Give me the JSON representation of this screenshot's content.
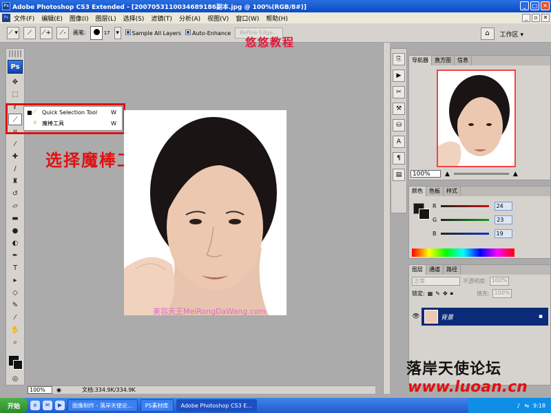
{
  "window": {
    "title": "Adobe Photoshop CS3 Extended - [2007053110034689186副本.jpg @ 100%(RGB/8#)]",
    "ctrl_min": "_",
    "ctrl_max": "□",
    "ctrl_close": "✕"
  },
  "menubar": {
    "items": [
      "文件(F)",
      "编辑(E)",
      "图像(I)",
      "图层(L)",
      "选择(S)",
      "滤镜(T)",
      "分析(A)",
      "视图(V)",
      "窗口(W)",
      "帮助(H)"
    ]
  },
  "options": {
    "brush_label": "画笔:",
    "brush_size": "17",
    "sample_all_layers": "Sample All Layers",
    "auto_enhance": "Auto-Enhance",
    "refine_edge": "Refine Edge...",
    "workspace": "工作区 ▾"
  },
  "tutorial_title": "悠悠教程",
  "flyout": {
    "items": [
      {
        "label": "Quick Selection Tool",
        "key": "W"
      },
      {
        "label": "魔棒工具",
        "key": "W"
      }
    ]
  },
  "caption": "选择魔棒工具",
  "document": {
    "watermark": "美容天王MeiRongDaWang.com",
    "zoom": "100%",
    "doc_info": "文档:334.9K/334.9K"
  },
  "navigator": {
    "tabs": [
      "导航器",
      "直方图",
      "信息"
    ],
    "zoom": "100%"
  },
  "color": {
    "tabs": [
      "颜色",
      "色板",
      "样式"
    ],
    "channels": [
      {
        "label": "R",
        "value": "24",
        "color": "#d01010"
      },
      {
        "label": "G",
        "value": "23",
        "color": "#10a010"
      },
      {
        "label": "B",
        "value": "19",
        "color": "#1030d0"
      }
    ]
  },
  "layers": {
    "tabs": [
      "图层",
      "通道",
      "路径"
    ],
    "blend_mode": "正常",
    "opacity_label": "不透明度:",
    "opacity": "100%",
    "lock_label": "锁定:",
    "fill_label": "填充:",
    "fill": "100%",
    "layer_name": "背景"
  },
  "branding": {
    "forum_name": "落岸天使论坛",
    "url": "www.luoan.cn"
  },
  "taskbar": {
    "start": "开始",
    "tasks": [
      "图像制作 - 落岸天使论...",
      "PS素材库",
      "Adobe Photoshop CS3 E..."
    ],
    "clock": "9:18"
  }
}
